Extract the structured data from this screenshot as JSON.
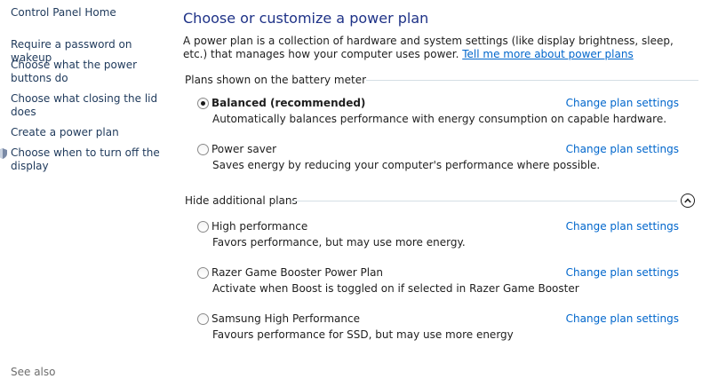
{
  "sidebar": {
    "home": "Control Panel Home",
    "links": [
      "Require a password on wakeup",
      "Choose what the power buttons do",
      "Choose what closing the lid does",
      "Create a power plan",
      "Choose when to turn off the display"
    ],
    "see_also": "See also"
  },
  "main": {
    "title": "Choose or customize a power plan",
    "intro": "A power plan is a collection of hardware and system settings (like display brightness, sleep, etc.) that manages how your computer uses power.",
    "intro_link": "Tell me more about power plans",
    "battery_section": "Plans shown on the battery meter",
    "additional_section": "Hide additional plans",
    "change_label": "Change plan settings",
    "plans": [
      {
        "name": "Balanced (recommended)",
        "desc": "Automatically balances performance with energy consumption on capable hardware.",
        "selected": true
      },
      {
        "name": "Power saver",
        "desc": "Saves energy by reducing your computer's performance where possible.",
        "selected": false
      },
      {
        "name": "High performance",
        "desc": "Favors performance, but may use more energy.",
        "selected": false
      },
      {
        "name": "Razer Game Booster Power Plan",
        "desc": "Activate when Boost is toggled on if selected in Razer Game Booster",
        "selected": false
      },
      {
        "name": "Samsung High Performance",
        "desc": "Favours performance for SSD, but may use more energy",
        "selected": false
      }
    ]
  },
  "colors": {
    "title": "#1e3287",
    "link": "#0066cc",
    "sidebar_link": "#1e395b"
  }
}
